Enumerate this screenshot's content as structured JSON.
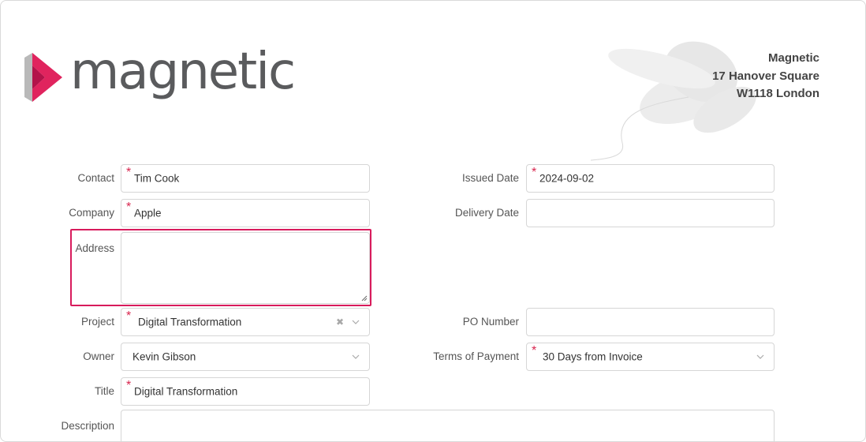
{
  "brand": {
    "name": "magnetic",
    "colors": {
      "accent": "#d81b5c",
      "mark_gray": "#b9b9b9",
      "text_gray": "#5a5b5d"
    }
  },
  "company_address": {
    "line1": "Magnetic",
    "line2": "17 Hanover Square",
    "line3": "W1118 London"
  },
  "form": {
    "contact": {
      "label": "Contact",
      "value": "Tim Cook",
      "required": true
    },
    "company": {
      "label": "Company",
      "value": "Apple",
      "required": true
    },
    "address": {
      "label": "Address",
      "value": ""
    },
    "project": {
      "label": "Project",
      "value": "Digital Transformation",
      "required": true
    },
    "owner": {
      "label": "Owner",
      "value": "Kevin Gibson"
    },
    "title": {
      "label": "Title",
      "value": "Digital Transformation",
      "required": true
    },
    "description": {
      "label": "Description",
      "value": ""
    },
    "issued_date": {
      "label": "Issued Date",
      "value": "2024-09-02",
      "required": true
    },
    "delivery_date": {
      "label": "Delivery Date",
      "value": ""
    },
    "po_number": {
      "label": "PO Number",
      "value": ""
    },
    "terms_of_payment": {
      "label": "Terms of Payment",
      "value": "30 Days from Invoice",
      "required": true
    }
  }
}
